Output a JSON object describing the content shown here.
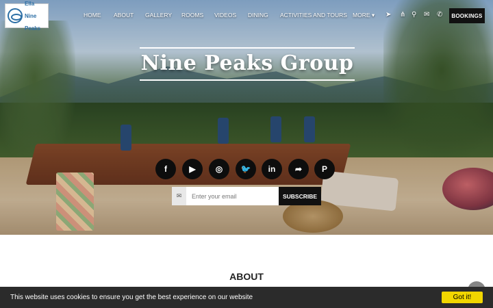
{
  "logo": {
    "line1": "Ella",
    "line2": "Nine",
    "line3": "Peaks"
  },
  "nav": {
    "items": [
      "HOME",
      "ABOUT",
      "GALLERY",
      "ROOMS",
      "VIDEOS",
      "DINING",
      "ACTIVITIES AND TOURS",
      "MORE ▾"
    ],
    "icons": [
      "navigation-arrow-icon",
      "share-icon",
      "search-icon",
      "envelope-icon",
      "phone-icon"
    ],
    "bookings_label": "BOOKINGS"
  },
  "hero": {
    "title": "Nine Peaks Group",
    "social": [
      {
        "name": "facebook",
        "glyph": "f"
      },
      {
        "name": "youtube",
        "glyph": "▶"
      },
      {
        "name": "instagram",
        "glyph": "◎"
      },
      {
        "name": "twitter",
        "glyph": "🐦"
      },
      {
        "name": "linkedin",
        "glyph": "in"
      },
      {
        "name": "share",
        "glyph": "➦"
      },
      {
        "name": "pinterest",
        "glyph": "P"
      }
    ],
    "subscribe": {
      "placeholder": "Enter your email",
      "button": "SUBSCRIBE"
    }
  },
  "about": {
    "heading": "ABOUT"
  },
  "cookie": {
    "message": "This website uses cookies to ensure you get the best experience on our website",
    "button": "Got it!"
  },
  "colors": {
    "brand": "#2d6fa5",
    "dark": "#111111",
    "cookie_button": "#f1d600"
  }
}
